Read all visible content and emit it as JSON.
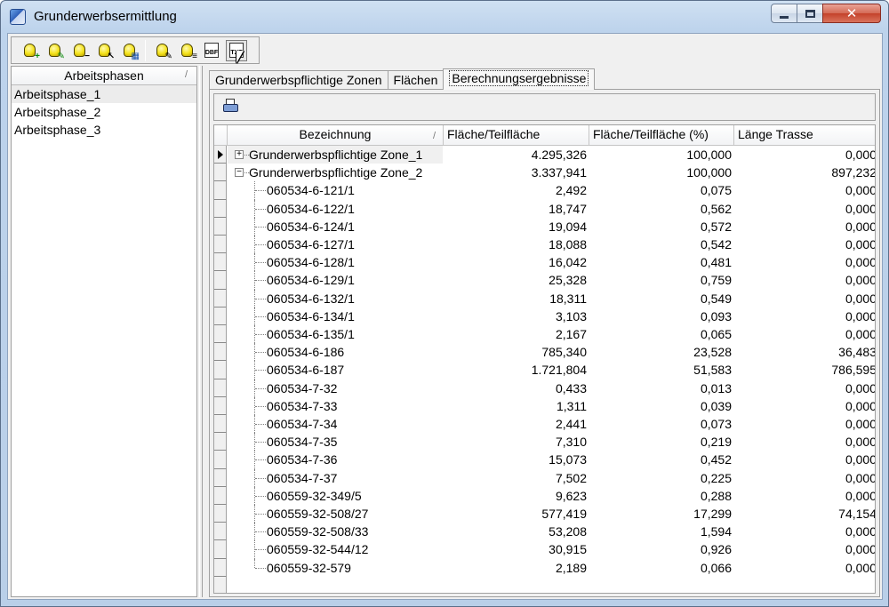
{
  "window": {
    "title": "Grunderwerbsermittlung",
    "controls": {
      "minimize": "minimize-icon",
      "maximize": "maximize-icon",
      "close": "close-icon"
    },
    "close_glyph": "✕"
  },
  "toolbar": {
    "buttons": [
      {
        "icon": "bulb-add-icon",
        "badge": "+"
      },
      {
        "icon": "bulb-edit-icon",
        "badge": "✎"
      },
      {
        "icon": "bulb-remove-icon",
        "badge": "−"
      },
      {
        "icon": "bulb-select-icon",
        "badge": "↖"
      },
      {
        "icon": "calculator-icon",
        "badge": "▦"
      },
      {
        "icon": "bulb-pen-icon",
        "badge": "✎"
      },
      {
        "icon": "bulb-list-icon",
        "badge": "≡"
      },
      {
        "icon": "export-dbf-icon",
        "label": "DBF"
      },
      {
        "icon": "export-txt-icon",
        "label": "TXT",
        "pressed": true
      }
    ]
  },
  "left_panel": {
    "header": "Arbeitsphasen",
    "sort_glyph": "/",
    "items": [
      "Arbeitsphase_1",
      "Arbeitsphase_2",
      "Arbeitsphase_3"
    ],
    "selected_index": 0
  },
  "tabs": [
    {
      "label": "Grunderwerbspflichtige Zonen",
      "active": false
    },
    {
      "label": "Flächen",
      "active": false
    },
    {
      "label": "Berechnungsergebnisse",
      "active": true
    }
  ],
  "results": {
    "toolbar_icon": "print-report-icon",
    "columns": {
      "name": "Bezeichnung",
      "area": "Fläche/Teilfläche",
      "percent": "Fläche/Teilfläche (%)",
      "length": "Länge Trasse"
    },
    "sort_glyph": "/",
    "rows": [
      {
        "level": 0,
        "expander": "+",
        "current": true,
        "name": "Grunderwerbspflichtige Zone_1",
        "area": "4.295,326",
        "percent": "100,000",
        "length": "0,000"
      },
      {
        "level": 0,
        "expander": "−",
        "current": false,
        "name": "Grunderwerbspflichtige Zone_2",
        "area": "3.337,941",
        "percent": "100,000",
        "length": "897,232"
      },
      {
        "level": 1,
        "name": "060534-6-121/1",
        "area": "2,492",
        "percent": "0,075",
        "length": "0,000"
      },
      {
        "level": 1,
        "name": "060534-6-122/1",
        "area": "18,747",
        "percent": "0,562",
        "length": "0,000"
      },
      {
        "level": 1,
        "name": "060534-6-124/1",
        "area": "19,094",
        "percent": "0,572",
        "length": "0,000"
      },
      {
        "level": 1,
        "name": "060534-6-127/1",
        "area": "18,088",
        "percent": "0,542",
        "length": "0,000"
      },
      {
        "level": 1,
        "name": "060534-6-128/1",
        "area": "16,042",
        "percent": "0,481",
        "length": "0,000"
      },
      {
        "level": 1,
        "name": "060534-6-129/1",
        "area": "25,328",
        "percent": "0,759",
        "length": "0,000"
      },
      {
        "level": 1,
        "name": "060534-6-132/1",
        "area": "18,311",
        "percent": "0,549",
        "length": "0,000"
      },
      {
        "level": 1,
        "name": "060534-6-134/1",
        "area": "3,103",
        "percent": "0,093",
        "length": "0,000"
      },
      {
        "level": 1,
        "name": "060534-6-135/1",
        "area": "2,167",
        "percent": "0,065",
        "length": "0,000"
      },
      {
        "level": 1,
        "name": "060534-6-186",
        "area": "785,340",
        "percent": "23,528",
        "length": "36,483"
      },
      {
        "level": 1,
        "name": "060534-6-187",
        "area": "1.721,804",
        "percent": "51,583",
        "length": "786,595"
      },
      {
        "level": 1,
        "name": "060534-7-32",
        "area": "0,433",
        "percent": "0,013",
        "length": "0,000"
      },
      {
        "level": 1,
        "name": "060534-7-33",
        "area": "1,311",
        "percent": "0,039",
        "length": "0,000"
      },
      {
        "level": 1,
        "name": "060534-7-34",
        "area": "2,441",
        "percent": "0,073",
        "length": "0,000"
      },
      {
        "level": 1,
        "name": "060534-7-35",
        "area": "7,310",
        "percent": "0,219",
        "length": "0,000"
      },
      {
        "level": 1,
        "name": "060534-7-36",
        "area": "15,073",
        "percent": "0,452",
        "length": "0,000"
      },
      {
        "level": 1,
        "name": "060534-7-37",
        "area": "7,502",
        "percent": "0,225",
        "length": "0,000"
      },
      {
        "level": 1,
        "name": "060559-32-349/5",
        "area": "9,623",
        "percent": "0,288",
        "length": "0,000"
      },
      {
        "level": 1,
        "name": "060559-32-508/27",
        "area": "577,419",
        "percent": "17,299",
        "length": "74,154"
      },
      {
        "level": 1,
        "name": "060559-32-508/33",
        "area": "53,208",
        "percent": "1,594",
        "length": "0,000"
      },
      {
        "level": 1,
        "name": "060559-32-544/12",
        "area": "30,915",
        "percent": "0,926",
        "length": "0,000"
      },
      {
        "level": 1,
        "name": "060559-32-579",
        "area": "2,189",
        "percent": "0,066",
        "length": "0,000"
      }
    ]
  }
}
